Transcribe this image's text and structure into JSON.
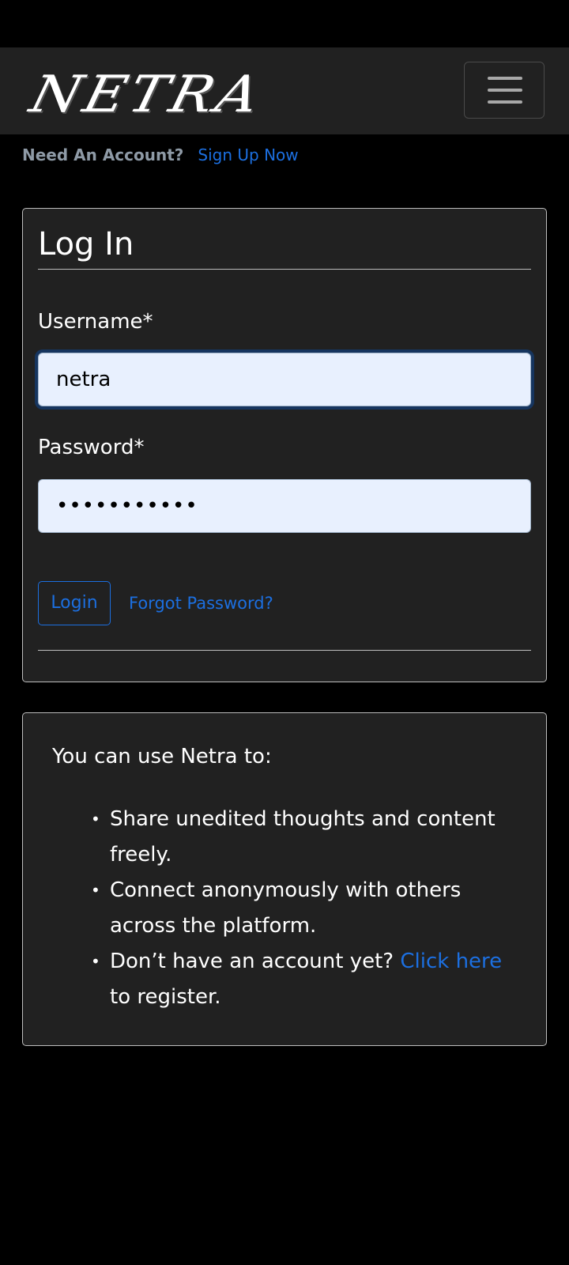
{
  "navbar": {
    "brand": "NETRA",
    "menu_icon": "hamburger-menu-icon"
  },
  "account_prompt": {
    "question": "Need An Account?",
    "signup_link": "Sign Up Now"
  },
  "login": {
    "title": "Log In",
    "username_label": "Username*",
    "username_value": "netra",
    "password_label": "Password*",
    "password_value": "•••••••••••",
    "login_button": "Login",
    "forgot_link": "Forgot Password?"
  },
  "info": {
    "intro": "You can use Netra to:",
    "item1": "Share unedited thoughts and content freely.",
    "item2": "Connect anonymously with others across the platform.",
    "item3_prefix": "Don’t have an account yet? ",
    "item3_link": "Click here",
    "item3_suffix": " to register."
  },
  "colors": {
    "background": "#000000",
    "panel": "#212121",
    "accent": "#1c6fe0",
    "muted_text": "#8e9aa6",
    "input_fill": "#e8f0fe"
  }
}
